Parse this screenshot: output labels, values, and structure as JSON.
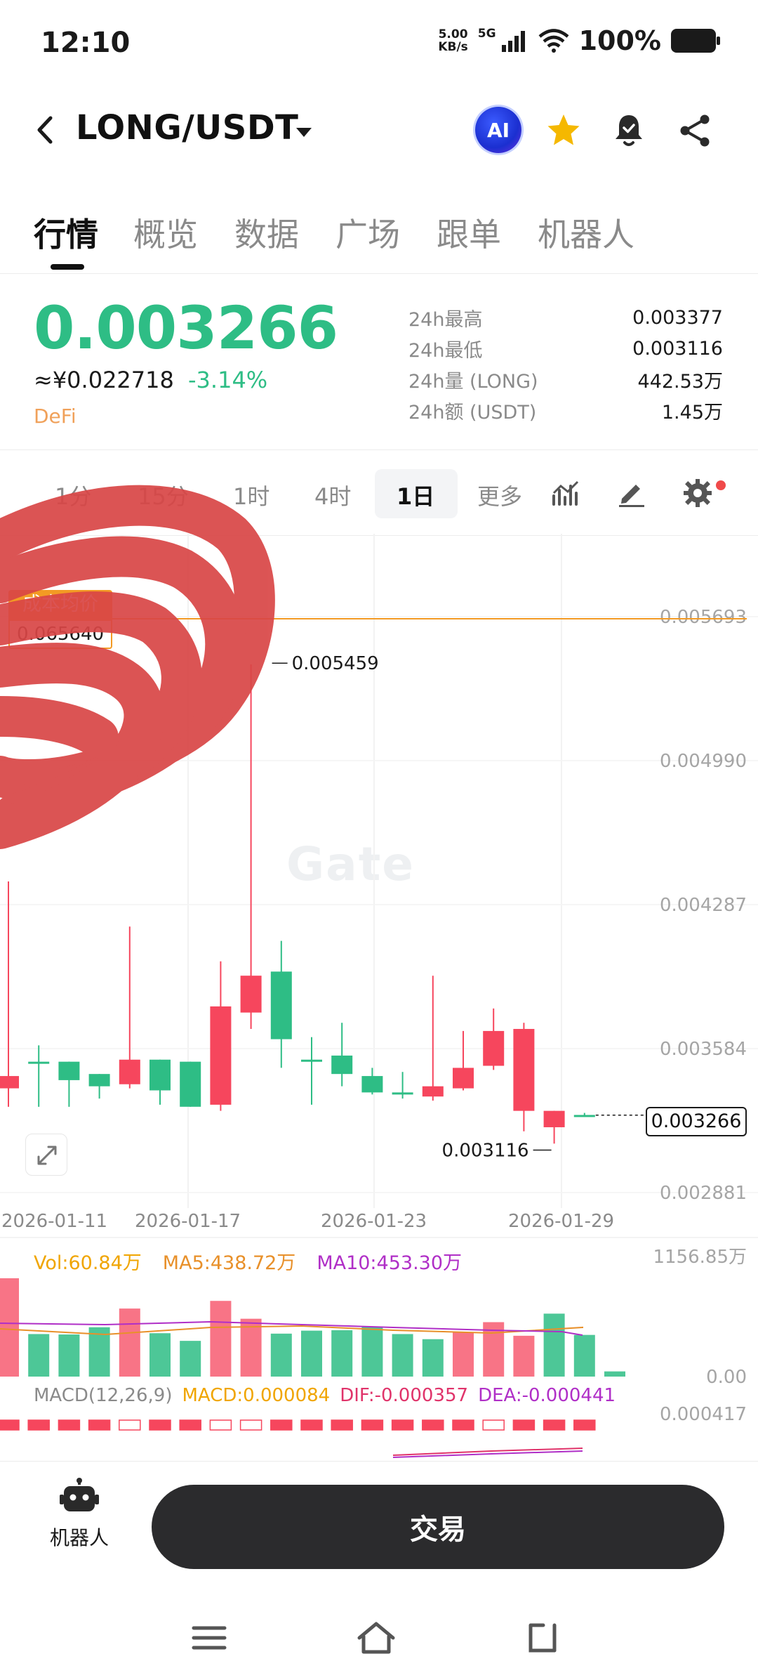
{
  "status": {
    "time": "12:10",
    "net_speed_top": "5.00",
    "net_speed_bottom": "KB/s",
    "network": "5G",
    "battery": "100%"
  },
  "header": {
    "pair": "LONG/USDT",
    "ai_label": "AI",
    "icons": [
      "back-icon",
      "caret-down-icon",
      "ai-icon",
      "star-icon",
      "bell-check-icon",
      "share-icon"
    ]
  },
  "tabs": [
    "行情",
    "概览",
    "数据",
    "广场",
    "跟单",
    "机器人"
  ],
  "ticker": {
    "last_price": "0.003266",
    "cny_price": "≈¥0.022718",
    "change": "-3.14%",
    "tag": "DeFi",
    "stats": [
      {
        "label": "24h最高",
        "value": "0.003377"
      },
      {
        "label": "24h最低",
        "value": "0.003116"
      },
      {
        "label": "24h量 (LONG)",
        "value": "442.53万"
      },
      {
        "label": "24h额 (USDT)",
        "value": "1.45万"
      }
    ]
  },
  "intervals": {
    "items": [
      "1分",
      "15分",
      "1时",
      "4时"
    ],
    "active": "1日",
    "more": "更多"
  },
  "chart": {
    "cost_avg_label": "成本均价",
    "cost_avg_value": "0.065640",
    "high_marker": "0.005459",
    "low_marker": "0.003116",
    "last_price_box": "0.003266",
    "watermark": "Gate",
    "colors": {
      "up": "#2ebd85",
      "down": "#f6465d",
      "cost_line": "#f39a24"
    }
  },
  "chart_data": {
    "type": "candlestick",
    "y_ticks": [
      "0.005693",
      "0.004990",
      "0.004287",
      "0.003584",
      "0.002881"
    ],
    "ylim": [
      0.002881,
      0.005693
    ],
    "x_ticks": [
      "2026-01-11",
      "2026-01-17",
      "2026-01-23",
      "2026-01-29"
    ],
    "candles": [
      {
        "o": 0.00345,
        "h": 0.0044,
        "l": 0.0033,
        "c": 0.00339
      },
      {
        "o": 0.00352,
        "h": 0.0036,
        "l": 0.0033,
        "c": 0.00352
      },
      {
        "o": 0.00343,
        "h": 0.00352,
        "l": 0.0033,
        "c": 0.00352
      },
      {
        "o": 0.0034,
        "h": 0.00346,
        "l": 0.00334,
        "c": 0.00346
      },
      {
        "o": 0.00353,
        "h": 0.00418,
        "l": 0.00339,
        "c": 0.00341
      },
      {
        "o": 0.00338,
        "h": 0.00353,
        "l": 0.00331,
        "c": 0.00353
      },
      {
        "o": 0.0033,
        "h": 0.00352,
        "l": 0.0033,
        "c": 0.00352
      },
      {
        "o": 0.00379,
        "h": 0.00401,
        "l": 0.00328,
        "c": 0.00331
      },
      {
        "o": 0.00394,
        "h": 0.00546,
        "l": 0.00368,
        "c": 0.00376
      },
      {
        "o": 0.00363,
        "h": 0.00411,
        "l": 0.00349,
        "c": 0.00396
      },
      {
        "o": 0.00353,
        "h": 0.00364,
        "l": 0.00331,
        "c": 0.00353
      },
      {
        "o": 0.00346,
        "h": 0.00371,
        "l": 0.0034,
        "c": 0.00355
      },
      {
        "o": 0.00337,
        "h": 0.00349,
        "l": 0.00336,
        "c": 0.00345
      },
      {
        "o": 0.00336,
        "h": 0.00347,
        "l": 0.00334,
        "c": 0.00337
      },
      {
        "o": 0.0034,
        "h": 0.00394,
        "l": 0.00333,
        "c": 0.00335
      },
      {
        "o": 0.00349,
        "h": 0.00367,
        "l": 0.00338,
        "c": 0.00339
      },
      {
        "o": 0.00367,
        "h": 0.00378,
        "l": 0.00348,
        "c": 0.0035
      },
      {
        "o": 0.00368,
        "h": 0.00371,
        "l": 0.00318,
        "c": 0.00328
      },
      {
        "o": 0.00328,
        "h": 0.00328,
        "l": 0.00312,
        "c": 0.0032
      },
      {
        "o": 0.00326,
        "h": 0.00327,
        "l": 0.00325,
        "c": 0.00326
      }
    ]
  },
  "volume": {
    "vol_label": "Vol:60.84万",
    "ma5_label": "MA5:438.72万",
    "ma10_label": "MA10:453.30万",
    "max_tick": "1156.85万",
    "zero_tick": "0.00",
    "bars": [
      1156,
      500,
      495,
      580,
      800,
      510,
      420,
      890,
      680,
      505,
      540,
      545,
      590,
      500,
      440,
      520,
      640,
      480,
      740,
      490,
      61
    ],
    "up": [
      false,
      true,
      true,
      true,
      false,
      true,
      true,
      false,
      false,
      true,
      true,
      true,
      true,
      true,
      true,
      false,
      false,
      false,
      true,
      true,
      true
    ]
  },
  "macd": {
    "params_label": "MACD(12,26,9)",
    "macd_label": "MACD:0.000084",
    "dif_label": "DIF:-0.000357",
    "dea_label": "DEA:-0.000441",
    "tick": "0.000417"
  },
  "bottom": {
    "robot_label": "机器人",
    "trade_label": "交易"
  }
}
